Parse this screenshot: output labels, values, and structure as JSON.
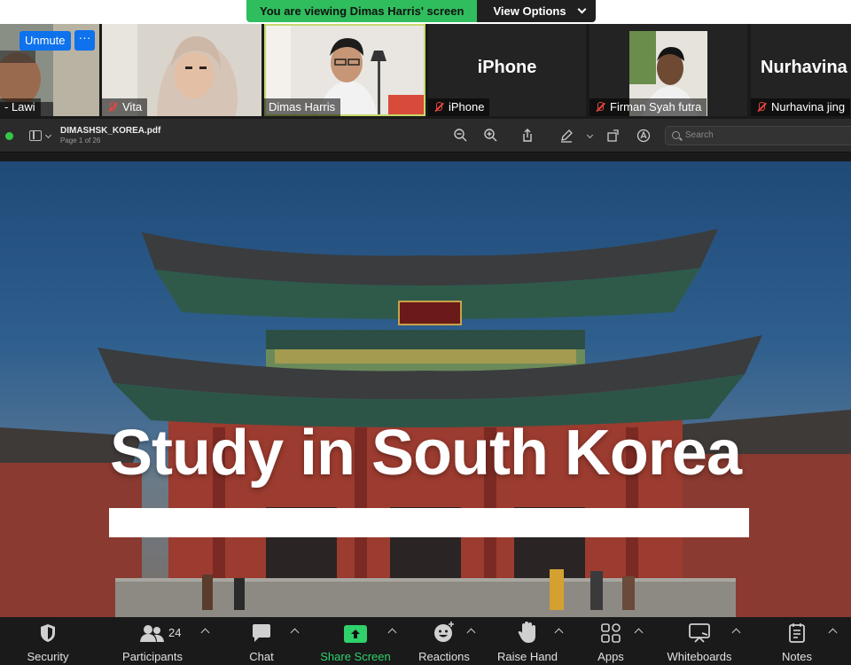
{
  "banner": {
    "message": "You are viewing Dimas Harris' screen",
    "view_options": "View Options"
  },
  "participants": {
    "self": {
      "name": "- Lawi",
      "unmute": "Unmute",
      "more": "···"
    },
    "tiles": [
      {
        "name": "Vita",
        "muted": true
      },
      {
        "name": "Dimas Harris",
        "muted": false,
        "active": true
      },
      {
        "name": "iPhone",
        "big_label": "iPhone",
        "muted": true
      },
      {
        "name": "Firman Syah futra",
        "muted": true
      },
      {
        "name": "Nurhavina jing",
        "big_label": "Nurhavina j",
        "muted": true
      }
    ]
  },
  "pdf_viewer": {
    "file_name": "DIMASHSK_KOREA.pdf",
    "page_info": "Page 1 of 26",
    "search_placeholder": "Search",
    "icons": [
      "sidebar-icon",
      "zoom-out-icon",
      "zoom-in-icon",
      "share-icon",
      "markup-pen-icon",
      "rotate-icon",
      "annotate-icon",
      "search-icon"
    ]
  },
  "slide": {
    "title": "Study in South Korea"
  },
  "toolbar": {
    "security": "Security",
    "participants": "Participants",
    "participant_count": "24",
    "chat": "Chat",
    "share_screen": "Share Screen",
    "reactions": "Reactions",
    "raise_hand": "Raise Hand",
    "apps": "Apps",
    "whiteboards": "Whiteboards",
    "notes": "Notes"
  },
  "colors": {
    "share_green": "#2fd16a",
    "banner_green": "#2fbd5e",
    "unmute_blue": "#0e72ed",
    "active_border": "#c6d96a",
    "muted_red": "#e8453c"
  }
}
